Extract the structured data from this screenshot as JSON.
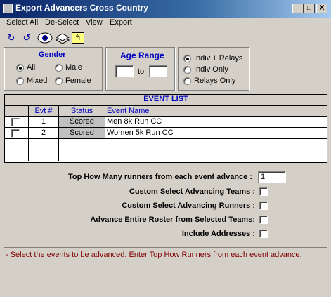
{
  "window": {
    "title": "Export Advancers Cross Country",
    "minimize": "_",
    "maximize": "□",
    "close": "X"
  },
  "menu": [
    "Select All",
    "De-Select",
    "View",
    "Export"
  ],
  "toolbar": {
    "redo_icon": "↻",
    "undo_icon": "↺",
    "view_icon": "👁",
    "stack_icon": "≡",
    "folder_icon": "↰"
  },
  "gender": {
    "title": "Gender",
    "options": [
      "All",
      "Male",
      "Mixed",
      "Female"
    ],
    "selected": "All"
  },
  "age_range": {
    "title": "Age Range",
    "from": "",
    "to_label": "to",
    "to": ""
  },
  "relay_filter": {
    "options": [
      "Indiv + Relays",
      "Indiv Only",
      "Relays Only"
    ],
    "selected": "Indiv + Relays"
  },
  "event_list": {
    "title": "EVENT LIST",
    "columns": [
      "",
      "Evt #",
      "Status",
      "Event Name"
    ],
    "rows": [
      {
        "checked": false,
        "evt": "1",
        "status": "Scored",
        "name": "Men 8k Run CC"
      },
      {
        "checked": false,
        "evt": "2",
        "status": "Scored",
        "name": "Women 5k Run CC"
      }
    ]
  },
  "options": {
    "top_how_many_label": "Top How Many runners from each event advance :",
    "top_how_many_value": "1",
    "custom_teams_label": "Custom Select Advancing Teams :",
    "custom_runners_label": "Custom Select Advancing Runners :",
    "entire_roster_label": "Advance Entire Roster from Selected Teams:",
    "include_addresses_label": "Include Addresses :"
  },
  "message": "- Select the events to be advanced.  Enter Top How Runners from each event advance.",
  "colors": {
    "title_blue": "#0a246a",
    "group_title": "#0000c0",
    "message_text": "#800000"
  }
}
